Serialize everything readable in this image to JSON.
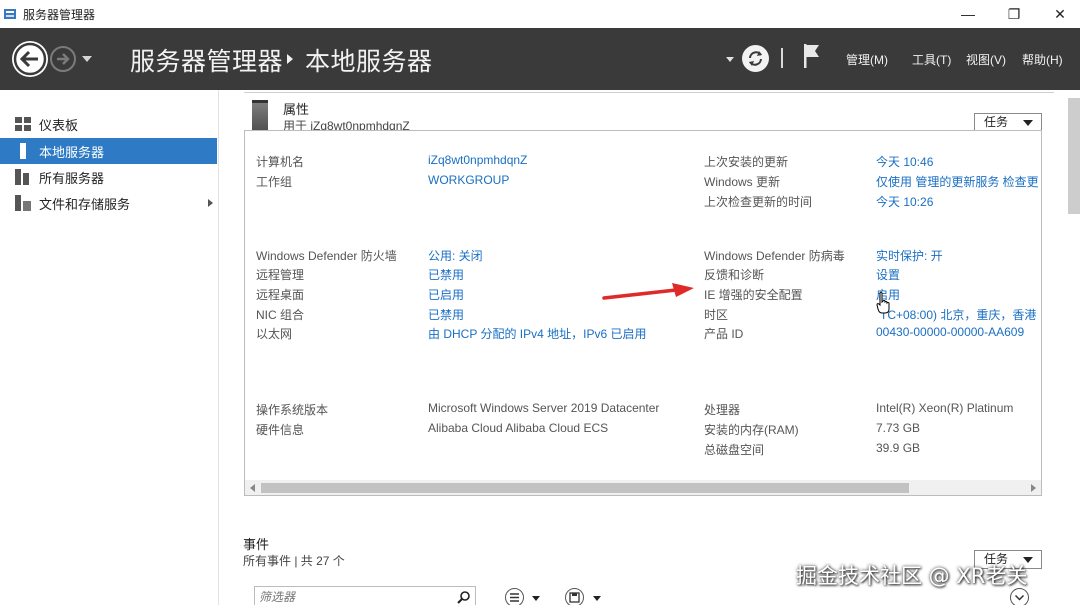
{
  "window": {
    "title": "服务器管理器",
    "minimize": "—",
    "restore": "❐",
    "close": "✕"
  },
  "header": {
    "breadcrumb_root": "服务器管理器",
    "breadcrumb_current": "本地服务器",
    "menus": [
      "管理(M)",
      "工具(T)",
      "视图(V)",
      "帮助(H)"
    ]
  },
  "sidebar": {
    "items": [
      {
        "label": "仪表板",
        "icon": "dashboard-icon",
        "active": false
      },
      {
        "label": "本地服务器",
        "icon": "local-server-icon",
        "active": true
      },
      {
        "label": "所有服务器",
        "icon": "all-servers-icon",
        "active": false
      },
      {
        "label": "文件和存储服务",
        "icon": "file-storage-icon",
        "active": false
      }
    ]
  },
  "properties": {
    "title": "属性",
    "subtitle": "用于 iZq8wt0npmhdqnZ",
    "tasks_label": "任务",
    "left": [
      {
        "label": "计算机名",
        "value": "iZq8wt0npmhdqnZ",
        "link": true
      },
      {
        "label": "工作组",
        "value": "WORKGROUP",
        "link": true
      },
      {
        "label": "Windows Defender 防火墙",
        "value": "公用: 关闭",
        "link": true
      },
      {
        "label": "远程管理",
        "value": "已禁用",
        "link": true
      },
      {
        "label": "远程桌面",
        "value": "已启用",
        "link": true
      },
      {
        "label": "NIC 组合",
        "value": "已禁用",
        "link": true
      },
      {
        "label": "以太网",
        "value": "由 DHCP 分配的 IPv4 地址，IPv6 已启用",
        "link": true
      },
      {
        "label": "操作系统版本",
        "value": "Microsoft Windows Server 2019 Datacenter",
        "link": false
      },
      {
        "label": "硬件信息",
        "value": "Alibaba Cloud Alibaba Cloud ECS",
        "link": false
      }
    ],
    "right": [
      {
        "label": "上次安装的更新",
        "value": "今天 10:46",
        "link": true
      },
      {
        "label": "Windows 更新",
        "value": "仅使用 管理的更新服务 检查更",
        "link": true
      },
      {
        "label": "上次检查更新的时间",
        "value": "今天 10:26",
        "link": true
      },
      {
        "label": "Windows Defender 防病毒",
        "value": "实时保护: 开",
        "link": true
      },
      {
        "label": "反馈和诊断",
        "value": "设置",
        "link": true
      },
      {
        "label": "IE 增强的安全配置",
        "value": "启用",
        "link": true
      },
      {
        "label": "时区",
        "value": "TC+08:00) 北京，重庆，香港",
        "link": true
      },
      {
        "label": "产品 ID",
        "value": "00430-00000-00000-AA609",
        "link": true
      },
      {
        "label": "处理器",
        "value": "Intel(R) Xeon(R) Platinum",
        "link": false
      },
      {
        "label": "安装的内存(RAM)",
        "value": "7.73 GB",
        "link": false
      },
      {
        "label": "总磁盘空间",
        "value": "39.9 GB",
        "link": false
      }
    ]
  },
  "events": {
    "title": "事件",
    "subtitle": "所有事件 | 共 27 个",
    "tasks_label": "任务",
    "filter_placeholder": "筛选器"
  },
  "watermark": "掘金技术社区 @ XR老关",
  "colors": {
    "header_bg": "#3a3a3a",
    "active_item": "#2e7ac4",
    "link": "#1a6fc4",
    "annotation_arrow": "#e02a2a"
  }
}
